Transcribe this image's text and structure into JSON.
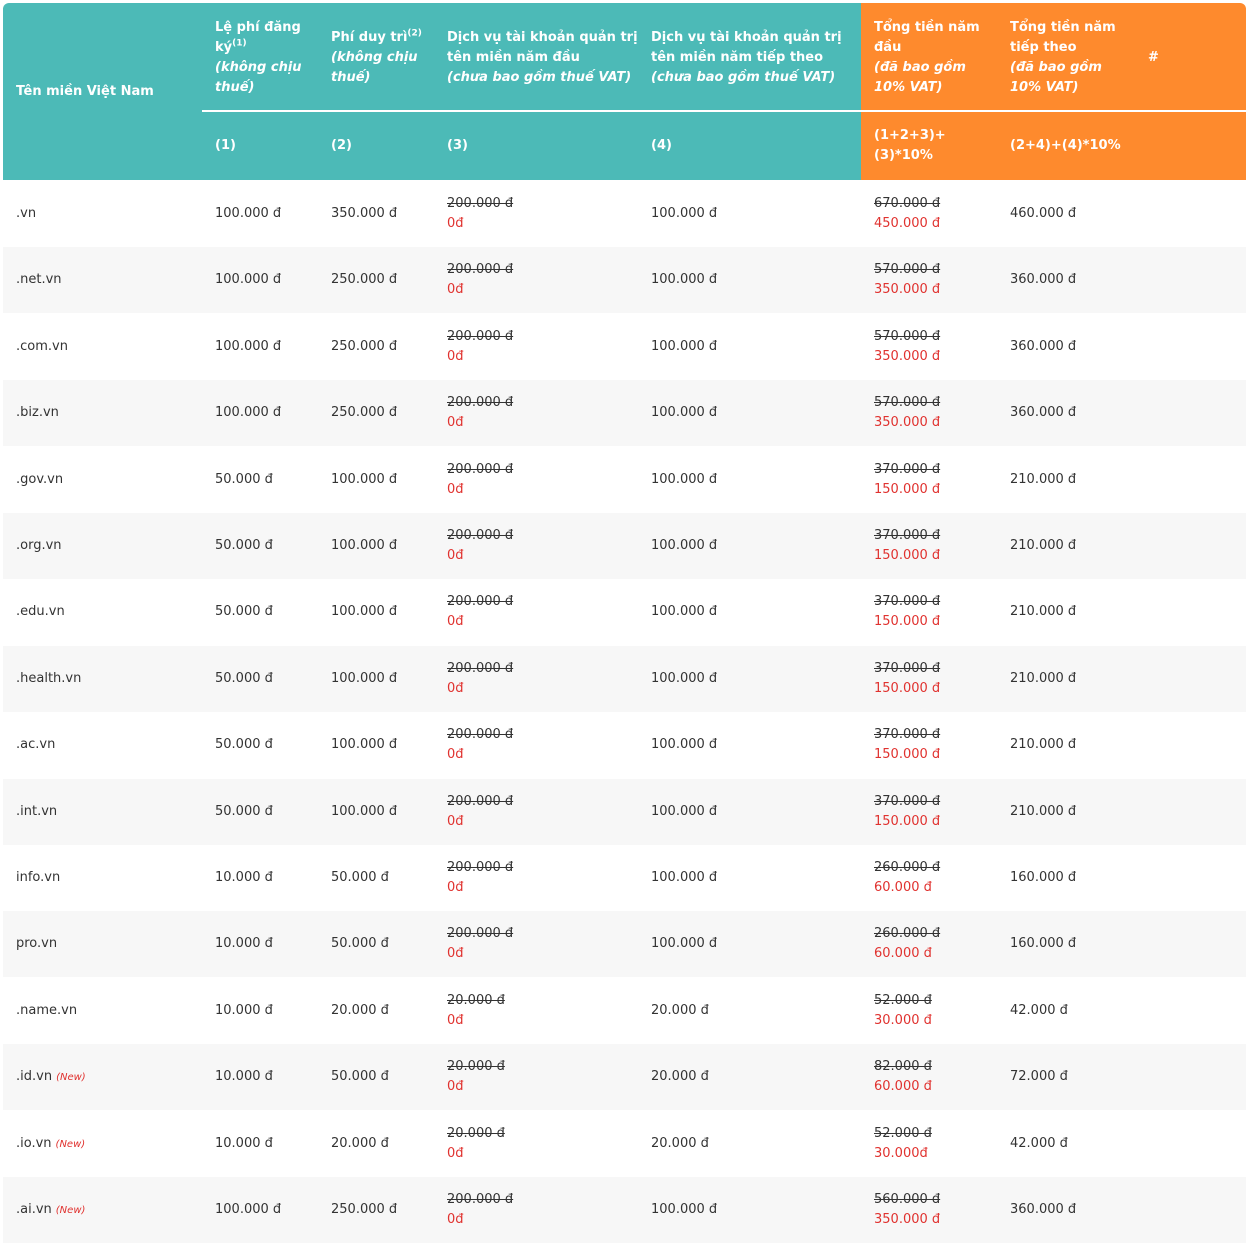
{
  "header": {
    "col_name": "Tên miền Việt Nam",
    "col1": {
      "title": "Lệ phí đăng ký",
      "sup": "(1)",
      "note": "(không chịu thuế)",
      "num": "(1)"
    },
    "col2": {
      "title": "Phí duy trì",
      "sup": "(2)",
      "note": "(không chịu thuế)",
      "num": "(2)"
    },
    "col3": {
      "title_l1": "Dịch vụ tài khoản quản trị",
      "title_l2": "tên miền năm đầu",
      "note": "(chưa bao gồm thuế VAT)",
      "num": "(3)"
    },
    "col4": {
      "title_l1": "Dịch vụ tài khoản quản trị",
      "title_l2": "tên miền năm tiếp theo",
      "note": "(chưa bao gồm thuế VAT)",
      "num": "(4)"
    },
    "col5": {
      "title_l1": "Tổng tiền năm",
      "title_l2": "đầu",
      "note_l1": "(đã bao gồm",
      "note_l2": "10% VAT)",
      "formula_l1": "(1+2+3)+",
      "formula_l2": "(3)*10%"
    },
    "col6": {
      "title_l1": "Tổng tiền năm",
      "title_l2": "tiếp theo",
      "note_l1": "(đã bao gồm",
      "note_l2": "10% VAT)",
      "formula": "(2+4)+(4)*10%"
    },
    "col7": "#"
  },
  "rows": [
    {
      "name": ".vn",
      "new": "",
      "reg": "100.000 đ",
      "maint": "350.000 đ",
      "svc_old": "200.000 đ",
      "svc_new": "0đ",
      "svc_next": "100.000 đ",
      "total_old": "670.000 đ",
      "total_new": "450.000 đ",
      "total_next": "460.000 đ"
    },
    {
      "name": ".net.vn",
      "new": "",
      "reg": "100.000 đ",
      "maint": "250.000 đ",
      "svc_old": "200.000 đ",
      "svc_new": "0đ",
      "svc_next": "100.000 đ",
      "total_old": "570.000 đ",
      "total_new": "350.000 đ",
      "total_next": "360.000 đ"
    },
    {
      "name": ".com.vn",
      "new": "",
      "reg": "100.000 đ",
      "maint": "250.000 đ",
      "svc_old": "200.000 đ",
      "svc_new": "0đ",
      "svc_next": "100.000 đ",
      "total_old": "570.000 đ",
      "total_new": "350.000 đ",
      "total_next": "360.000 đ"
    },
    {
      "name": ".biz.vn",
      "new": "",
      "reg": "100.000 đ",
      "maint": "250.000 đ",
      "svc_old": "200.000 đ",
      "svc_new": "0đ",
      "svc_next": "100.000 đ",
      "total_old": "570.000 đ",
      "total_new": "350.000 đ",
      "total_next": "360.000 đ"
    },
    {
      "name": ".gov.vn",
      "new": "",
      "reg": "50.000 đ",
      "maint": "100.000 đ",
      "svc_old": "200.000 đ",
      "svc_new": "0đ",
      "svc_next": "100.000 đ",
      "total_old": "370.000 đ",
      "total_new": "150.000 đ",
      "total_next": "210.000 đ"
    },
    {
      "name": ".org.vn",
      "new": "",
      "reg": "50.000 đ",
      "maint": "100.000 đ",
      "svc_old": "200.000 đ",
      "svc_new": "0đ",
      "svc_next": "100.000 đ",
      "total_old": "370.000 đ",
      "total_new": "150.000 đ",
      "total_next": "210.000 đ"
    },
    {
      "name": ".edu.vn",
      "new": "",
      "reg": "50.000 đ",
      "maint": "100.000 đ",
      "svc_old": "200.000 đ",
      "svc_new": "0đ",
      "svc_next": "100.000 đ",
      "total_old": "370.000 đ",
      "total_new": "150.000 đ",
      "total_next": "210.000 đ"
    },
    {
      "name": ".health.vn",
      "new": "",
      "reg": "50.000 đ",
      "maint": "100.000 đ",
      "svc_old": "200.000 đ",
      "svc_new": "0đ",
      "svc_next": "100.000 đ",
      "total_old": "370.000 đ",
      "total_new": "150.000 đ",
      "total_next": "210.000 đ"
    },
    {
      "name": ".ac.vn",
      "new": "",
      "reg": "50.000 đ",
      "maint": "100.000 đ",
      "svc_old": "200.000 đ",
      "svc_new": "0đ",
      "svc_next": "100.000 đ",
      "total_old": "370.000 đ",
      "total_new": "150.000 đ",
      "total_next": "210.000 đ"
    },
    {
      "name": ".int.vn",
      "new": "",
      "reg": "50.000 đ",
      "maint": "100.000 đ",
      "svc_old": "200.000 đ",
      "svc_new": "0đ",
      "svc_next": "100.000 đ",
      "total_old": "370.000 đ",
      "total_new": "150.000 đ",
      "total_next": "210.000 đ"
    },
    {
      "name": "info.vn",
      "new": "",
      "reg": "10.000 đ",
      "maint": "50.000 đ",
      "svc_old": "200.000 đ",
      "svc_new": "0đ",
      "svc_next": "100.000 đ",
      "total_old": "260.000 đ",
      "total_new": "60.000 đ",
      "total_next": "160.000 đ"
    },
    {
      "name": "pro.vn",
      "new": "",
      "reg": "10.000 đ",
      "maint": "50.000 đ",
      "svc_old": "200.000 đ",
      "svc_new": "0đ",
      "svc_next": "100.000 đ",
      "total_old": "260.000 đ",
      "total_new": "60.000 đ",
      "total_next": "160.000 đ"
    },
    {
      "name": ".name.vn",
      "new": "",
      "reg": "10.000 đ",
      "maint": "20.000 đ",
      "svc_old": "20.000 đ",
      "svc_new": "0đ",
      "svc_next": "20.000 đ",
      "total_old": "52.000 đ",
      "total_new": "30.000 đ",
      "total_next": "42.000 đ"
    },
    {
      "name": ".id.vn",
      "new": "(New)",
      "reg": "10.000 đ",
      "maint": "50.000 đ",
      "svc_old": "20.000 đ",
      "svc_new": "0đ",
      "svc_next": "20.000 đ",
      "total_old": "82.000 đ",
      "total_new": "60.000 đ",
      "total_next": "72.000 đ"
    },
    {
      "name": ".io.vn",
      "new": "(New)",
      "reg": "10.000 đ",
      "maint": "20.000 đ",
      "svc_old": "20.000 đ",
      "svc_new": "0đ",
      "svc_next": "20.000 đ",
      "total_old": "52.000 đ",
      "total_new": "30.000đ",
      "total_next": "42.000 đ"
    },
    {
      "name": ".ai.vn",
      "new": "(New)",
      "reg": "100.000 đ",
      "maint": "250.000 đ",
      "svc_old": "200.000 đ",
      "svc_new": "0đ",
      "svc_next": "100.000 đ",
      "total_old": "560.000 đ",
      "total_new": "350.000 đ",
      "total_next": "360.000 đ"
    }
  ]
}
